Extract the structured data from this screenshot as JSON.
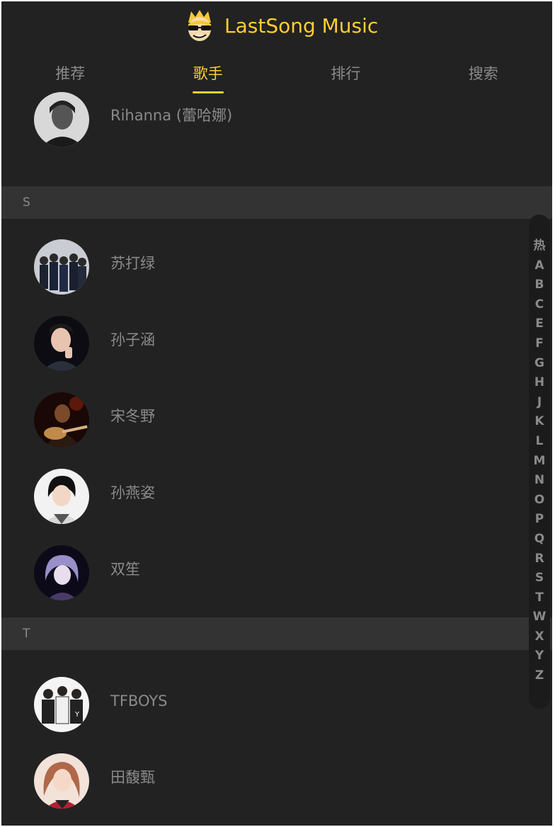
{
  "header": {
    "title": "LastSong Music",
    "logo_icon": "cartoon-face-logo"
  },
  "tabs": [
    {
      "label": "推荐",
      "active": false
    },
    {
      "label": "歌手",
      "active": true
    },
    {
      "label": "排行",
      "active": false
    },
    {
      "label": "搜索",
      "active": false
    }
  ],
  "singers": {
    "r_tail": {
      "name": "Rihanna (蕾哈娜)"
    },
    "group_s": {
      "title": "S",
      "items": [
        {
          "name": "苏打绿"
        },
        {
          "name": "孙子涵"
        },
        {
          "name": "宋冬野"
        },
        {
          "name": "孙燕姿"
        },
        {
          "name": "双笙"
        }
      ]
    },
    "group_t": {
      "title": "T",
      "items": [
        {
          "name": "TFBOYS"
        },
        {
          "name": "田馥甄"
        }
      ]
    }
  },
  "shortcut": [
    "热",
    "A",
    "B",
    "C",
    "E",
    "F",
    "G",
    "H",
    "J",
    "K",
    "L",
    "M",
    "N",
    "O",
    "P",
    "Q",
    "R",
    "S",
    "T",
    "W",
    "X",
    "Y",
    "Z"
  ],
  "colors": {
    "accent": "#ffcd32",
    "background": "#222222",
    "group_bg": "#333333",
    "text": "#8a8a8a"
  }
}
